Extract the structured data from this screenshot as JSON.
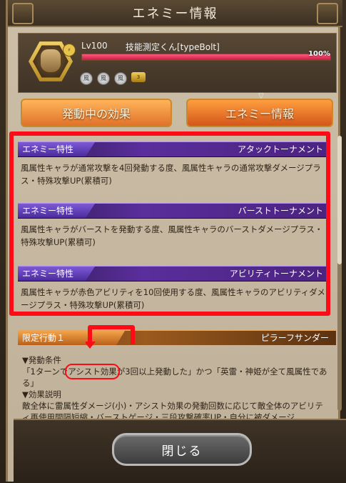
{
  "window": {
    "title": "エネミー情報"
  },
  "enemy": {
    "level": "Lv100",
    "name": "技能測定くん[typeBolt]",
    "hp_percent_label": "100%",
    "hp_fraction": 1.0,
    "element_icons": [
      "element-icon-1",
      "element-icon-2",
      "element-icon-3"
    ],
    "chip_label": "3"
  },
  "tabs": [
    {
      "label": "発動中の効果"
    },
    {
      "label": "エネミー情報"
    }
  ],
  "traits": [
    {
      "tag": "エネミー特性",
      "name": "アタックトーナメント",
      "description": "風属性キャラが通常攻撃を4回発動する度、風属性キャラの通常攻撃ダメージプラス・特殊攻撃UP(累積可)"
    },
    {
      "tag": "エネミー特性",
      "name": "バーストトーナメント",
      "description": "風属性キャラがバーストを発動する度、風属性キャラのバーストダメージプラス・特殊攻撃UP(累積可)"
    },
    {
      "tag": "エネミー特性",
      "name": "アビリティトーナメント",
      "description": "風属性キャラが赤色アビリティを10回使用する度、風属性キャラのアビリティダメージプラス・特殊攻撃UP(累積可)"
    }
  ],
  "limited_action": {
    "tag": "限定行動１",
    "name": "ピラーフサンダー",
    "condition_heading": "▼発動条件",
    "condition_pre": "「1ターンで",
    "condition_circled": "アシスト効果",
    "condition_post": "が3回以上発動した」かつ「英雷・神姫が全て風属性である」",
    "effect_heading": "▼効果説明",
    "effect_text": "敵全体に雷属性ダメージ(小)・アシスト効果の発動回数に応じて敵全体のアビリティ再使用間隔短縮・バーストゲージ・三段攻撃確率UP・自分に被ダメージ"
  },
  "buttons": {
    "close": "閉じる"
  }
}
